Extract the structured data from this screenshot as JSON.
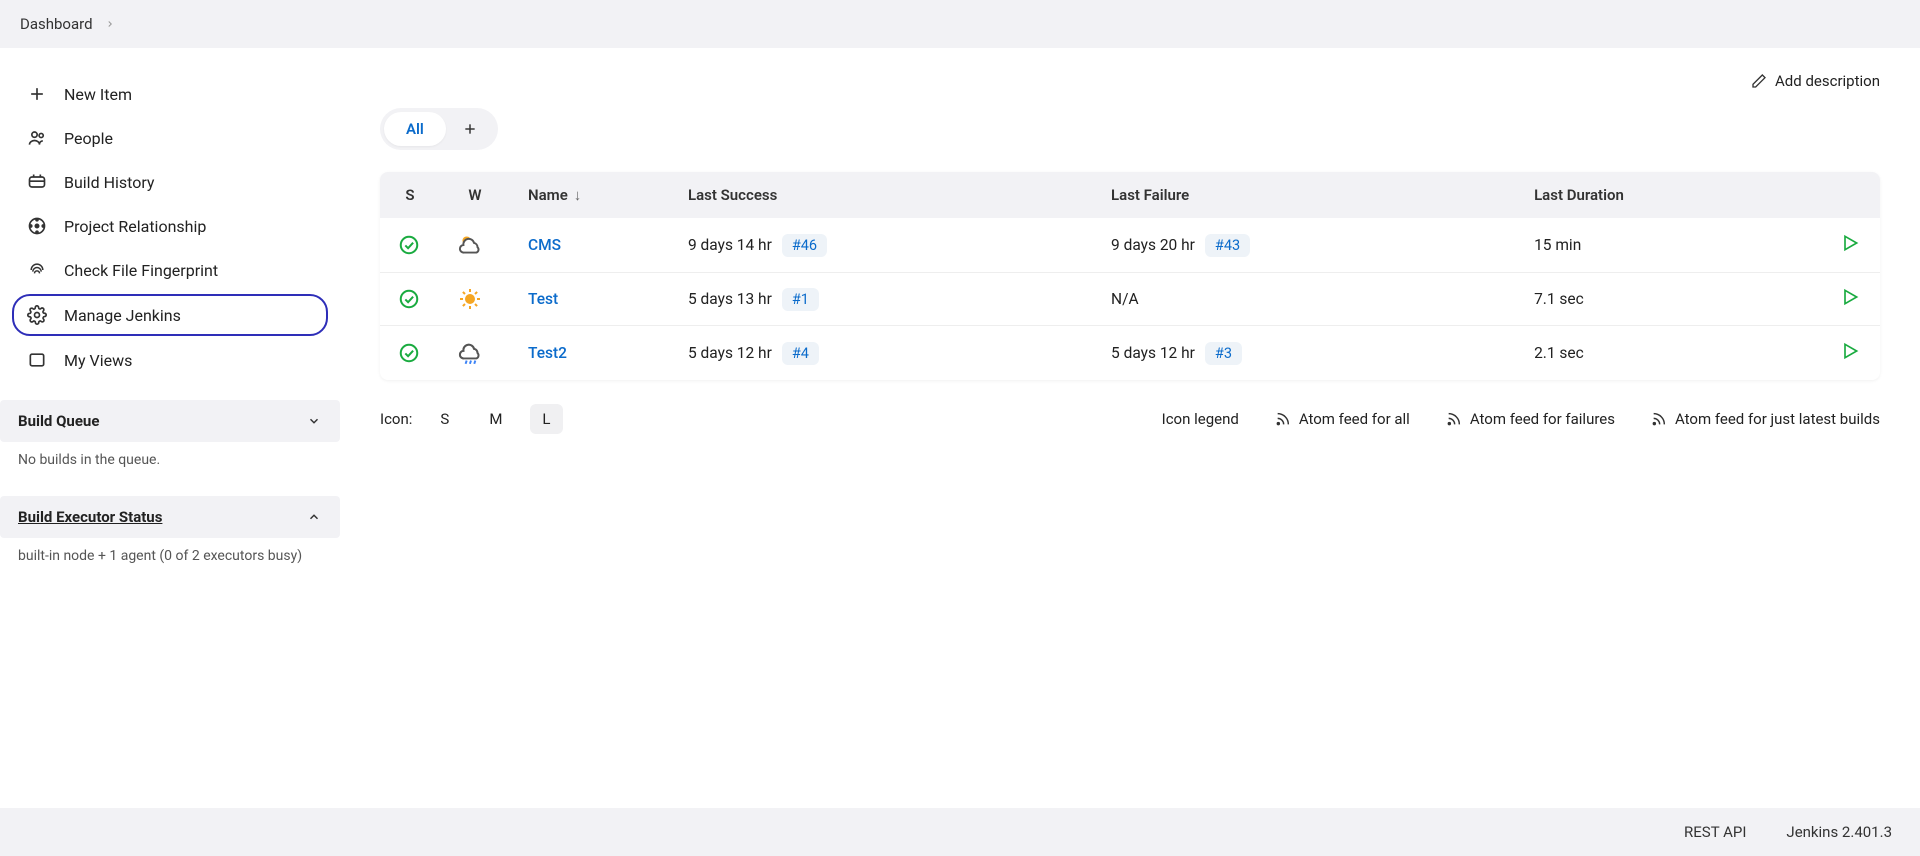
{
  "breadcrumb": {
    "root": "Dashboard"
  },
  "sidebar": {
    "items": [
      {
        "label": "New Item"
      },
      {
        "label": "People"
      },
      {
        "label": "Build History"
      },
      {
        "label": "Project Relationship"
      },
      {
        "label": "Check File Fingerprint"
      },
      {
        "label": "Manage Jenkins"
      },
      {
        "label": "My Views"
      }
    ],
    "build_queue": {
      "title": "Build Queue",
      "empty_text": "No builds in the queue."
    },
    "executor": {
      "title": "Build Executor Status",
      "summary": "built-in node + 1 agent (0 of 2 executors busy)"
    }
  },
  "actions": {
    "add_description": "Add description"
  },
  "tabs": {
    "all": "All"
  },
  "table": {
    "headers": {
      "status": "S",
      "weather": "W",
      "name": "Name",
      "last_success": "Last Success",
      "last_failure": "Last Failure",
      "last_duration": "Last Duration"
    },
    "rows": [
      {
        "name": "CMS",
        "last_success_time": "9 days 14 hr",
        "last_success_build": "#46",
        "last_failure_time": "9 days 20 hr",
        "last_failure_build": "#43",
        "duration": "15 min",
        "weather": "partly-cloudy"
      },
      {
        "name": "Test",
        "last_success_time": "5 days 13 hr",
        "last_success_build": "#1",
        "last_failure_time": "N/A",
        "last_failure_build": "",
        "duration": "7.1 sec",
        "weather": "sunny"
      },
      {
        "name": "Test2",
        "last_success_time": "5 days 12 hr",
        "last_success_build": "#4",
        "last_failure_time": "5 days 12 hr",
        "last_failure_build": "#3",
        "duration": "2.1 sec",
        "weather": "rainy"
      }
    ]
  },
  "footer_controls": {
    "icon_label": "Icon:",
    "sizes": {
      "s": "S",
      "m": "M",
      "l": "L"
    },
    "icon_legend": "Icon legend",
    "feed_all": "Atom feed for all",
    "feed_failures": "Atom feed for failures",
    "feed_latest": "Atom feed for just latest builds"
  },
  "page_footer": {
    "rest_api": "REST API",
    "version": "Jenkins 2.401.3"
  }
}
